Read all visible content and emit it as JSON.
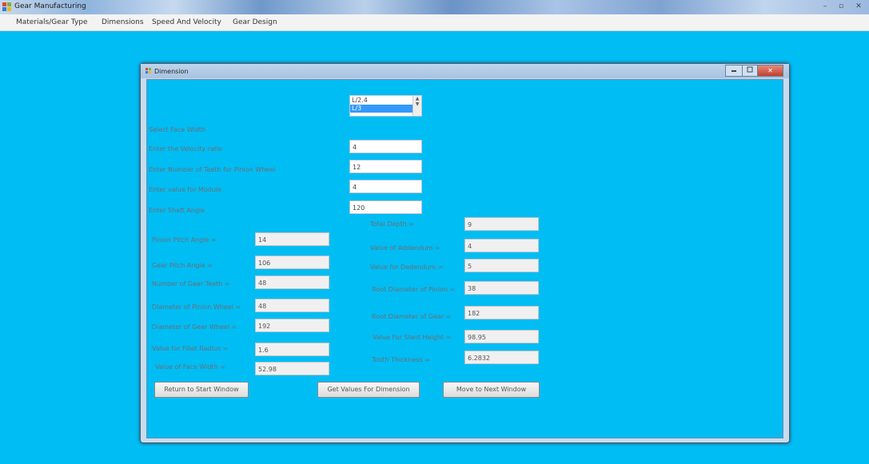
{
  "app": {
    "title": "Gear Manufacturing"
  },
  "window_controls": {
    "minimize": "–",
    "maximize": "▫",
    "close": "✕"
  },
  "menu": [
    "Materials/Gear Type",
    "Dimensions",
    "Speed And Velocity",
    "Gear Design"
  ],
  "child_window": {
    "title": "Dimension",
    "close": "✕"
  },
  "face_width": {
    "label": "Select Face Width",
    "options": [
      "L/2.4",
      "L/3"
    ],
    "selected": "L/3"
  },
  "inputs": [
    {
      "label": "Enter the Velocity ratio",
      "value": "4"
    },
    {
      "label": "Enter Number of Teeth for Pinion Wheel",
      "value": "12"
    },
    {
      "label": "Enter value for Module",
      "value": "4"
    },
    {
      "label": "Enter Shaft Angle",
      "value": "120"
    }
  ],
  "results_left": [
    {
      "label": "Pinion Pitch Angle =",
      "value": "14"
    },
    {
      "label": "Gear Pitch Angle =",
      "value": "106"
    },
    {
      "label": "Number of Gear Teeth =",
      "value": "48"
    },
    {
      "label": "Diameter of Pinion Wheel =",
      "value": "48"
    },
    {
      "label": "Diameter of Gear Wheel =",
      "value": "192"
    },
    {
      "label": "Value for Fillet Radius =",
      "value": "1.6"
    },
    {
      "label": "Value of Face Width =",
      "value": "52.98"
    }
  ],
  "results_right": [
    {
      "label": "Total Depth =",
      "value": "9"
    },
    {
      "label": "Value of Addendum =",
      "value": "4"
    },
    {
      "label": "Value for Dedendum =",
      "value": "5"
    },
    {
      "label": "Root Diameter of Pinion =",
      "value": "38"
    },
    {
      "label": "Root Diameter of Gear =",
      "value": "182"
    },
    {
      "label": "Value For Slant Height =",
      "value": "98.95"
    },
    {
      "label": "Tooth Thickness =",
      "value": "6.2832"
    }
  ],
  "buttons": {
    "return": "Return to Start Window",
    "get_values": "Get Values For Dimension",
    "next": "Move to Next Window"
  },
  "colors": {
    "background": "#00bdf4",
    "selection": "#3399ff",
    "close_button": "#c2402c"
  }
}
